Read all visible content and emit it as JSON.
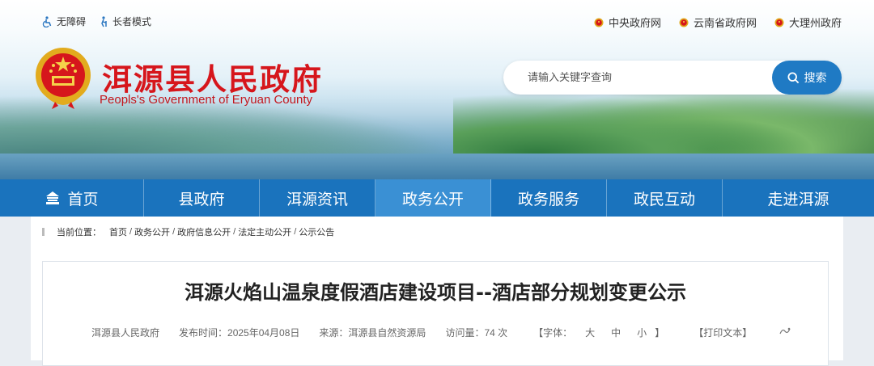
{
  "top_links": {
    "accessibility": "无障碍",
    "elder_mode": "长者模式"
  },
  "gov_links": [
    "中央政府网",
    "云南省政府网",
    "大理州政府"
  ],
  "site": {
    "title_cn": "洱源县人民政府",
    "title_en": "Peopls's Government of Eryuan County"
  },
  "search": {
    "placeholder": "请输入关键字查询",
    "button_label": "搜索"
  },
  "nav": [
    "首页",
    "县政府",
    "洱源资讯",
    "政务公开",
    "政务服务",
    "政民互动",
    "走进洱源"
  ],
  "nav_active_index": 3,
  "breadcrumb": {
    "label": "当前位置：",
    "items": [
      "首页",
      "政务公开",
      "政府信息公开",
      "法定主动公开",
      "公示公告"
    ],
    "separator": "/"
  },
  "article": {
    "title": "洱源火焰山温泉度假酒店建设项目--酒店部分规划变更公示",
    "source_org": "洱源县人民政府",
    "publish_time": "发布时间：2025年04月08日",
    "source": "来源：洱源县自然资源局",
    "views": "访问量：74 次",
    "font_label": "【字体：",
    "font_sizes": [
      "大",
      "中",
      "小"
    ],
    "font_close": "】",
    "print_label": "【打印文本】"
  },
  "colors": {
    "brand_red": "#d6161c",
    "nav_blue": "#1a73bd",
    "nav_active": "#3a90d4",
    "search_button": "#1f7ac4"
  },
  "icons": [
    "accessibility-icon",
    "elder-mode-icon",
    "emblem-icon",
    "search-icon",
    "home-icon",
    "share-icon"
  ]
}
